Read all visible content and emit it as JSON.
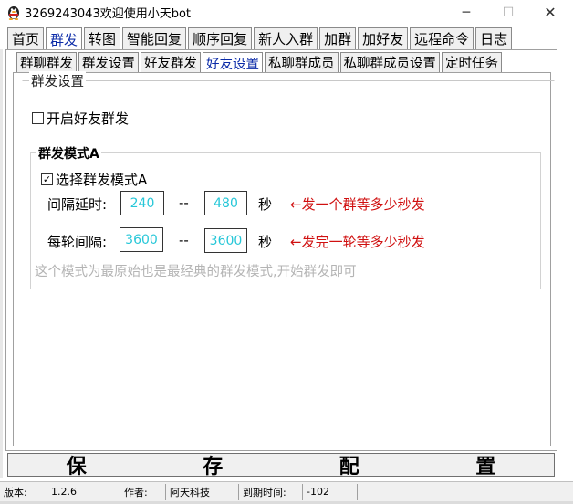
{
  "window": {
    "title": "3269243043欢迎使用小天bot",
    "minimize_glyph": "─",
    "maximize_glyph": "☐",
    "close_glyph": "✕"
  },
  "main_tabs": [
    {
      "label": "首页"
    },
    {
      "label": "群发"
    },
    {
      "label": "转图"
    },
    {
      "label": "智能回复"
    },
    {
      "label": "顺序回复"
    },
    {
      "label": "新人入群"
    },
    {
      "label": "加群"
    },
    {
      "label": "加好友"
    },
    {
      "label": "远程命令"
    },
    {
      "label": "日志"
    }
  ],
  "sub_tabs": [
    {
      "label": "群聊群发"
    },
    {
      "label": "群发设置"
    },
    {
      "label": "好友群发"
    },
    {
      "label": "好友设置"
    },
    {
      "label": "私聊群成员"
    },
    {
      "label": "私聊群成员设置"
    },
    {
      "label": "定时任务"
    }
  ],
  "settings": {
    "group_title": "群发设置",
    "enable_friend_broadcast": {
      "label": "开启好友群发",
      "checked": false
    },
    "mode_group_title": "群发模式A",
    "select_mode_a": {
      "label": "选择群发模式A",
      "checked": true
    },
    "interval_delay": {
      "label": "间隔延时:",
      "min": "240",
      "max": "480",
      "separator": "--",
      "unit": "秒",
      "hint": "←发一个群等多少秒发"
    },
    "round_interval": {
      "label": "每轮间隔:",
      "min": "3600",
      "max": "3600",
      "separator": "--",
      "unit": "秒",
      "hint": "←发完一轮等多少秒发"
    },
    "mode_note": "这个模式为最原始也是最经典的群发模式,开始群发即可"
  },
  "save_button": {
    "chars": [
      "保",
      "存",
      "配",
      "置"
    ]
  },
  "statusbar": {
    "version_label": "版本:",
    "version_value": "1.2.6",
    "author_label": "作者:",
    "author_value": "阿天科技",
    "expiry_label": "到期时间:",
    "expiry_value": "-102"
  },
  "colors": {
    "active_tab_text": "#0b2ba8",
    "field_value": "#27c7d8",
    "hint_text": "#d01010",
    "note_text": "#b4b4b4"
  }
}
